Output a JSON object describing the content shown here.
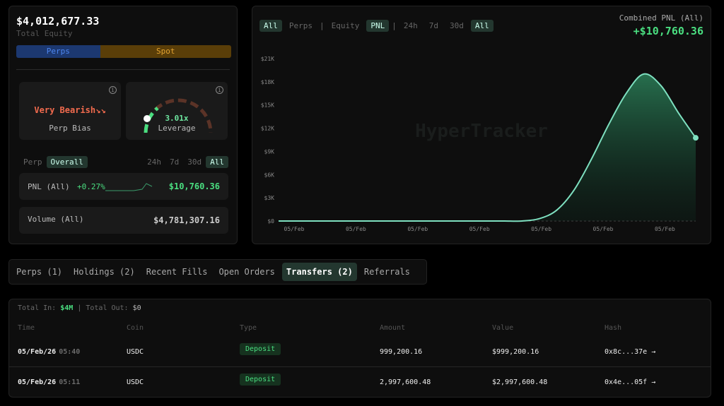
{
  "summary": {
    "total_equity": "$4,012,677.33",
    "total_equity_label": "Total Equity",
    "perps_label": "Perps",
    "spot_label": "Spot",
    "perps_share_pct": 39,
    "bias_value": "Very Bearish",
    "bias_icon": "trend-down-icon",
    "bias_label": "Perp Bias",
    "leverage_value": "3.01x",
    "leverage_label": "Leverage",
    "scope": [
      "Perp",
      "Overall"
    ],
    "scope_selected": "Overall",
    "timeframes": [
      "24h",
      "7d",
      "30d",
      "All"
    ],
    "timeframe_selected": "All",
    "pnl_label": "PNL (All)",
    "pnl_pct": "+0.27%",
    "pnl_value": "$10,760.36",
    "volume_label": "Volume (All)",
    "volume_value": "$4,781,307.16"
  },
  "chart_panel": {
    "filters": [
      "All",
      "Perps",
      "|",
      "Equity",
      "PNL",
      "|",
      "24h",
      "7d",
      "30d",
      "All"
    ],
    "selected": [
      0,
      4,
      9
    ],
    "combined_label": "Combined PNL (All)",
    "combined_value": "+$10,760.36",
    "watermark": "HyperTracker"
  },
  "chart_data": {
    "type": "area",
    "ylim": [
      0,
      21000
    ],
    "yticks": [
      "$0",
      "$3K",
      "$6K",
      "$9K",
      "$12K",
      "$15K",
      "$18K",
      "$21K"
    ],
    "xticks": [
      "05/Feb",
      "05/Feb",
      "05/Feb",
      "05/Feb",
      "05/Feb",
      "05/Feb",
      "05/Feb"
    ],
    "values": [
      0,
      0,
      0,
      0,
      0,
      0,
      0,
      0,
      0,
      0,
      0,
      0,
      0,
      0,
      0,
      300,
      1400,
      4000,
      8000,
      12500,
      16500,
      19000,
      17500,
      14000,
      10760.36
    ],
    "line_color": "#7ee0c0",
    "grid": false
  },
  "tabs": [
    "Perps (1)",
    "Holdings (2)",
    "Recent Fills",
    "Open Orders",
    "Transfers (2)",
    "Referrals"
  ],
  "tab_selected": 4,
  "transfers": {
    "total_in_label": "Total In:",
    "total_in": "$4M",
    "total_out_label": "Total Out:",
    "total_out": "$0",
    "columns": [
      "Time",
      "Coin",
      "Type",
      "Amount",
      "Value",
      "Hash"
    ],
    "rows": [
      {
        "date": "05/Feb/26",
        "time": "05:40",
        "coin": "USDC",
        "type": "Deposit",
        "amount": "999,200.16",
        "value": "$999,200.16",
        "hash": "0x8c...37e"
      },
      {
        "date": "05/Feb/26",
        "time": "05:11",
        "coin": "USDC",
        "type": "Deposit",
        "amount": "2,997,600.48",
        "value": "$2,997,600.48",
        "hash": "0x4e...05f"
      }
    ]
  }
}
